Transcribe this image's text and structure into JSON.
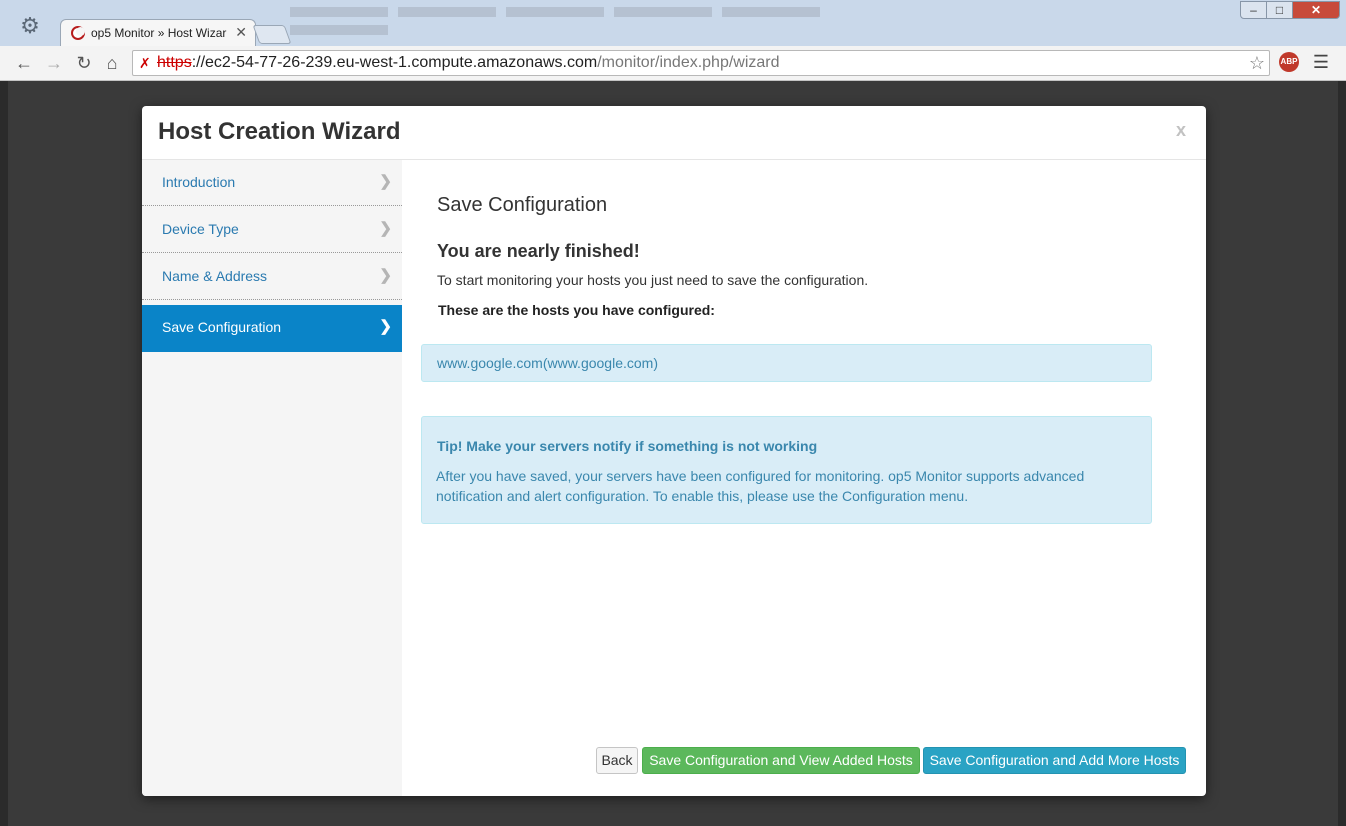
{
  "browser": {
    "tab_title": "op5 Monitor » Host Wizar",
    "url_scheme": "https",
    "url_host": "://ec2-54-77-26-239.eu-west-1.compute.amazonaws.com",
    "url_path": "/monitor/index.php/wizard",
    "abp_label": "ABP"
  },
  "modal": {
    "title": "Host Creation Wizard",
    "close_label": "x"
  },
  "sidebar": {
    "items": [
      {
        "label": "Introduction",
        "active": false
      },
      {
        "label": "Device Type",
        "active": false
      },
      {
        "label": "Name & Address",
        "active": false
      },
      {
        "label": "Save Configuration",
        "active": true
      }
    ]
  },
  "content": {
    "section_title": "Save Configuration",
    "subheading": "You are nearly finished!",
    "description": "To start monitoring your hosts you just need to save the configuration.",
    "hosts_label": "These are the hosts you have configured:",
    "hosts": [
      "www.google.com(www.google.com)"
    ],
    "tip_heading": "Tip! Make your servers notify if something is not working",
    "tip_body": "After you have saved, your servers have been configured for monitoring. op5 Monitor supports advanced notification and alert configuration. To enable this, please use the Configuration menu."
  },
  "buttons": {
    "back": "Back",
    "save_view": "Save Configuration and View Added Hosts",
    "save_more": "Save Configuration and Add More Hosts"
  },
  "colors": {
    "active_nav": "#0a84c8",
    "success_button": "#5cb85c",
    "info_button": "#2aa3c4",
    "info_box": "#d9edf7",
    "info_text": "#3a87ad"
  }
}
